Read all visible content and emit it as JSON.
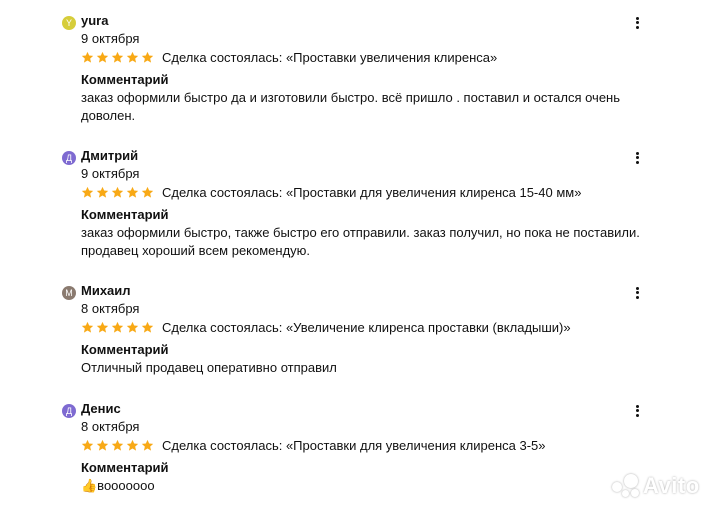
{
  "colors": {
    "star": "#f8a916",
    "avatar_y": "#d6cd3a",
    "avatar_d": "#7e6ad1",
    "avatar_m": "#8a7a6f"
  },
  "reviews": [
    {
      "avatar_letter": "Y",
      "author": "yura",
      "date": "9 октября",
      "rating": 5,
      "deal": "Сделка состоялась: «Проставки увеличения клиренса»",
      "comment_label": "Комментарий",
      "comment": "заказ оформили быстро да и изготовили быстро. всё пришло . поставил и остался очень доволен."
    },
    {
      "avatar_letter": "Д",
      "author": "Дмитрий",
      "date": "9 октября",
      "rating": 5,
      "deal": "Сделка состоялась: «Проставки для увеличения клиренса 15-40 мм»",
      "comment_label": "Комментарий",
      "comment": "заказ оформили быстро, также быстро его отправили. заказ получил, но пока не поставили. продавец хороший всем рекомендую."
    },
    {
      "avatar_letter": "М",
      "author": "Михаил",
      "date": "8 октября",
      "rating": 5,
      "deal": "Сделка состоялась: «Увеличение клиренса проставки (вкладыши)»",
      "comment_label": "Комментарий",
      "comment": "Отличный продавец оперативно отправил"
    },
    {
      "avatar_letter": "Д",
      "author": "Денис",
      "date": "8 октября",
      "rating": 5,
      "deal": "Сделка состоялась: «Проставки для увеличения клиренса 3-5»",
      "comment_label": "Комментарий",
      "comment": "👍вооооооо"
    }
  ],
  "watermark": {
    "text": "Avito"
  }
}
